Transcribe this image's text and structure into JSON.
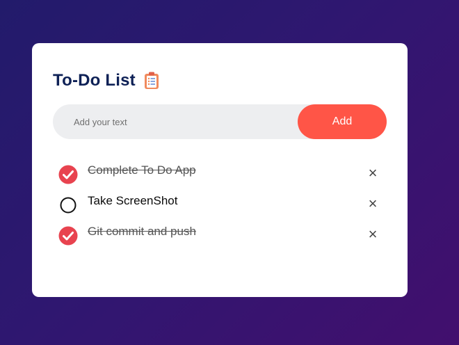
{
  "app": {
    "title": "To-Do List",
    "title_icon": "clipboard-icon"
  },
  "input": {
    "value": "",
    "placeholder": "Add your text"
  },
  "add_button": {
    "label": "Add"
  },
  "items": [
    {
      "text": "Complete To Do App",
      "checked": true
    },
    {
      "text": "Take ScreenShot",
      "checked": false
    },
    {
      "text": "Git commit and push",
      "checked": true
    }
  ],
  "delete_icon": "×",
  "colors": {
    "accent": "#ff5547",
    "title": "#0e2156",
    "checked": "#e8434f",
    "background_start": "#221b6b",
    "background_end": "#420f6e"
  }
}
